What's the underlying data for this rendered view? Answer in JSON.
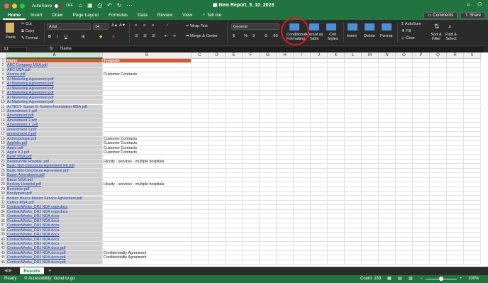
{
  "titlebar": {
    "autosave_label": "AutoSave",
    "autosave_state": "OFF",
    "title": "New Report_5_10_2023"
  },
  "tabs": [
    "Home",
    "Insert",
    "Draw",
    "Page Layout",
    "Formulas",
    "Data",
    "Review",
    "View",
    "Tell me"
  ],
  "tab_buttons": {
    "comments": "Comments",
    "share": "Share"
  },
  "ribbon": {
    "paste": "Paste",
    "cut": "Cut",
    "copy": "Copy",
    "format": "Format",
    "font_name": "Arial",
    "font_size": "14",
    "wrap_text": "Wrap Text",
    "merge_center": "Merge & Center",
    "number_format": "General",
    "conditional_formatting": "Conditional Formatting",
    "format_as_table": "Format as Table",
    "cell_styles": "Cell Styles",
    "insert": "Insert",
    "delete": "Delete",
    "format_cells": "Format",
    "autosum": "AutoSum",
    "fill": "Fill",
    "clear": "Clear",
    "sort_filter": "Sort & Filter",
    "find_select": "Find & Select"
  },
  "formula_bar": {
    "namebox": "A1",
    "fx": "fx",
    "content": "Name"
  },
  "columns": [
    "A",
    "B",
    "C",
    "D",
    "E",
    "F",
    "G",
    "H",
    "I",
    "J",
    "K",
    "L",
    "M",
    "N",
    "O",
    "P",
    "Q",
    "R",
    "S"
  ],
  "rows": [
    {
      "n": "1",
      "a": "Name",
      "b": "Template"
    },
    {
      "n": "2",
      "a": "ABC Company MSA.pdf",
      "b": ""
    },
    {
      "n": "3",
      "a": "ABC MSA.pdf",
      "b": ""
    },
    {
      "n": "4",
      "a": "Acorea.pdf",
      "b": "Customer Contracts"
    },
    {
      "n": "5",
      "a": "AI Marketing Agreement.pdf",
      "b": ""
    },
    {
      "n": "6",
      "a": "AI Marketing Agreement.pdf",
      "b": ""
    },
    {
      "n": "7",
      "a": "AI Marketing Agreement.pdf",
      "b": ""
    },
    {
      "n": "8",
      "a": "AI Marketing Agreement.pdf",
      "b": ""
    },
    {
      "n": "9",
      "a": "AI Marketing Agreement.pdf",
      "b": ""
    },
    {
      "n": "10",
      "a": "AI Marketing Agreement.pdf",
      "b": ""
    },
    {
      "n": "11",
      "a": "AI TEST- Susan G. Komen Foundation MSA.pdf",
      "b": ""
    },
    {
      "n": "12",
      "a": "Amendment 1.pdf",
      "b": ""
    },
    {
      "n": "13",
      "a": "Amendment.pdf",
      "b": ""
    },
    {
      "n": "14",
      "a": "Amendment 2.pdf",
      "b": ""
    },
    {
      "n": "15",
      "a": "Amendment 1 .pdf",
      "b": ""
    },
    {
      "n": "16",
      "a": "amendment 1.pdf",
      "b": ""
    },
    {
      "n": "17",
      "a": "amendment 2.pdf",
      "b": ""
    },
    {
      "n": "18",
      "a": "Anthropologie.pdf",
      "b": "Customer Contracts"
    },
    {
      "n": "19",
      "a": "Appfolio.pdf",
      "b": "Customer Contracts"
    },
    {
      "n": "20",
      "a": "Apple.pdf",
      "b": "Customer Contracts"
    },
    {
      "n": "21",
      "a": "Apple V.2.pdf",
      "b": "Customer Contracts"
    },
    {
      "n": "22",
      "a": "BanP MSA.pdf",
      "b": ""
    },
    {
      "n": "23",
      "a": "Barbourville Hospital .pdf",
      "b": "Hicuity - services - multiple hospitals"
    },
    {
      "n": "24",
      "a": "Basic Non-Disclosure Agreement FE.pdf",
      "b": ""
    },
    {
      "n": "25",
      "a": "Basic Non-Disclosure Agreement.pdf",
      "b": ""
    },
    {
      "n": "26",
      "a": "Bauer Amendment.pdf",
      "b": ""
    },
    {
      "n": "27",
      "a": "Bauer MSA.pdf",
      "b": ""
    },
    {
      "n": "28",
      "a": "Beckley Hospital.pdf",
      "b": "Hicuity - services - multiple hospitals"
    },
    {
      "n": "29",
      "a": "Berkshire.pdf",
      "b": ""
    },
    {
      "n": "30",
      "a": "BonAppetit.pdf",
      "b": ""
    },
    {
      "n": "31",
      "a": "Boston Bruins Master Service Agreement.pdf",
      "b": ""
    },
    {
      "n": "32",
      "a": "Celtics MSA.pdf",
      "b": ""
    },
    {
      "n": "33",
      "a": "ContractWorks_DRJ NDA copy.docx",
      "b": ""
    },
    {
      "n": "34",
      "a": "ContractWorks_DRJ NDA copy.docx",
      "b": ""
    },
    {
      "n": "35",
      "a": "ContractWorks_DRJ NDA.docx",
      "b": ""
    },
    {
      "n": "36",
      "a": "ContractWorks_DRJ NDA.docx",
      "b": ""
    },
    {
      "n": "37",
      "a": "ContractWorks_DRJ NDA.docx",
      "b": ""
    },
    {
      "n": "38",
      "a": "ContractWorks_DRJ NDA.docx",
      "b": ""
    },
    {
      "n": "39",
      "a": "ContractWorks_DRJ NDA.docx",
      "b": ""
    },
    {
      "n": "40",
      "a": "ContractWorks_DRJ NDA.docx",
      "b": ""
    },
    {
      "n": "41",
      "a": "ContractWorks_DRJ NDA.docx",
      "b": ""
    },
    {
      "n": "42",
      "a": "ContractWorks_DRJ NDA.docx.pdf",
      "b": ""
    },
    {
      "n": "43",
      "a": "ContractWorks_DRJ NDA.docx.pdf",
      "b": "Confidentiality Agreement"
    },
    {
      "n": "44",
      "a": "ContractWorks_DRJ NDA.docx.pdf",
      "b": "Confidentiality Agreement"
    },
    {
      "n": "45",
      "a": "ContractWorks_DRJ NDA.docx.pdf",
      "b": ""
    }
  ],
  "sheet": {
    "name": "Results"
  },
  "status": {
    "ready": "Ready",
    "accessibility": "Accessibility: Good to go",
    "count": "Count: 183",
    "zoom": "100%"
  }
}
